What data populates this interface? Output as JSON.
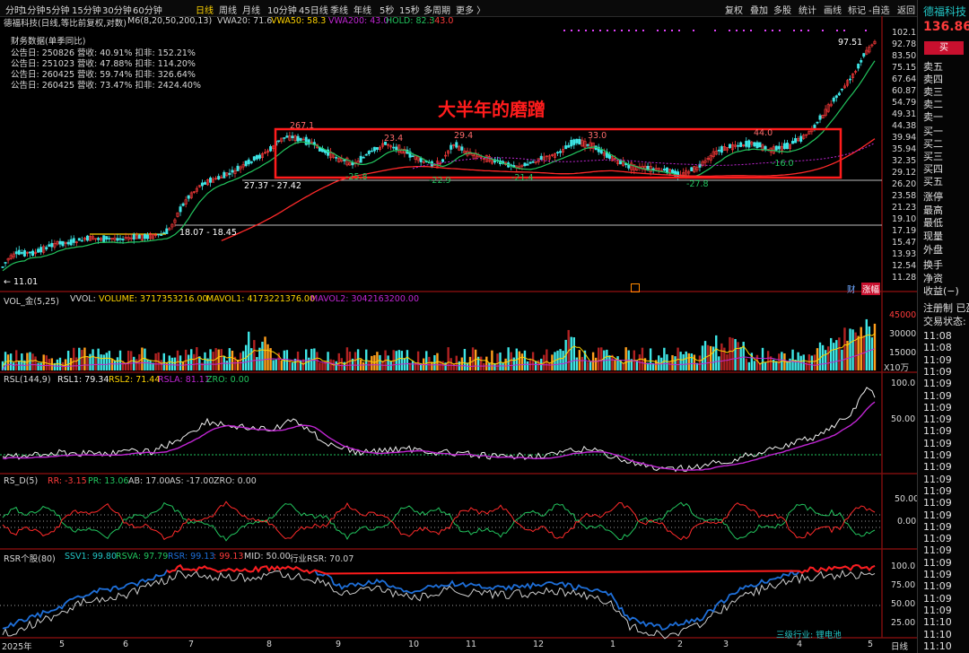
{
  "toolbar": {
    "periods": [
      "分时",
      "1分钟",
      "5分钟",
      "15分钟",
      "30分钟",
      "60分钟",
      "日线",
      "周线",
      "月线",
      "10分钟",
      "45日线",
      "季线",
      "年线",
      "5秒",
      "15秒",
      "多周期",
      "更多 〉"
    ],
    "active_period": "日线",
    "tools": [
      "复权",
      "叠加",
      "多股",
      "统计",
      "画线",
      "标记",
      "-自选",
      "返回"
    ]
  },
  "stock": {
    "name": "德福科技",
    "price": "136.86",
    "buy_button": "买",
    "quote_labels": [
      "卖五",
      "卖四",
      "卖三",
      "卖二",
      "卖一",
      "买一",
      "买二",
      "买三",
      "买四",
      "买五",
      "涨停",
      "最高",
      "最低",
      "现量",
      "外盘",
      "换手",
      "净资",
      "收益(−)"
    ],
    "reg_line": "注册制 已盈",
    "trade_status": "交易状态: 正"
  },
  "ticks": {
    "times": [
      "11:08",
      "11:08",
      "11:09",
      "11:09",
      "11:09",
      "11:09",
      "11:09",
      "11:09",
      "11:09",
      "11:09",
      "11:09",
      "11:09",
      "11:09",
      "11:09",
      "11:09",
      "11:09",
      "11:09",
      "11:09",
      "11:09",
      "11:09",
      "11:09",
      "11:09",
      "11:09",
      "11:09",
      "11:10",
      "11:10",
      "11:10"
    ]
  },
  "main_panel": {
    "header_name": "德福科技(日线,等比前复权,对数)",
    "header_ma": "M6(8,20,50,200,13)",
    "header_vwa20": "VWA20: 71.6",
    "header_vwa50": "VWA50: 58.3",
    "header_vwa200": "VWA200: 43.0",
    "header_hold": "HOLD: 82.3",
    "header_hold2": ": 43.0",
    "finance_title": "财务数据(单季同比)",
    "finance_rows": [
      "公告日: 250826  营收:  40.91%  扣非:  152.21%",
      "公告日: 251023  营收:  47.88%  扣非:  114.20%",
      "公告日: 260425  营收:  59.74%  扣非:  326.64%",
      "公告日: 260425  营收:  73.47%  扣非:  2424.40%"
    ],
    "annotation_title": "大半年的磨蹭",
    "price_labels": [
      "267.1",
      "23.4",
      "29.4",
      "33.0",
      "44.0",
      "97.51",
      "-16.0",
      "-27.8",
      "-22.9",
      "-21.4",
      "-25.8",
      "27.37 - 27.42",
      "18.07 - 18.45",
      "← 11.01"
    ],
    "y_ticks": [
      "102.1",
      "92.78",
      "83.50",
      "75.15",
      "67.64",
      "60.87",
      "54.79",
      "49.31",
      "44.38",
      "39.94",
      "35.94",
      "32.35",
      "29.12",
      "26.20",
      "23.58",
      "21.23",
      "19.10",
      "17.19",
      "15.47",
      "13.93",
      "12.54",
      "11.28"
    ],
    "badges": [
      "财",
      "涨幅"
    ]
  },
  "vol_panel": {
    "header_name": "VOL_金(5,25)",
    "header_vvol": "VVOL:",
    "header_volume": "VOLUME: 3717353216.00",
    "header_mavol1": "MAVOL1: 4173221376.00",
    "header_mavol2": "MAVOL2: 3042163200.00",
    "y_ticks": [
      "45000",
      "30000",
      "15000"
    ],
    "unit": "X10万"
  },
  "rsl_panel": {
    "header_name": "RSL(144,9)",
    "header_rsl1": "RSL1: 79.34",
    "header_rsl2": "RSL2: 71.44",
    "header_rsla": "RSLA: 81.11",
    "header_zro": "ZRO: 0.00",
    "y_ticks": [
      "100.0",
      "50.00"
    ]
  },
  "rsd_panel": {
    "header_name": "RS_D(5)",
    "header_rr": "RR: -3.15",
    "header_pr": "PR: 13.06",
    "header_ab": "AB: 17.00",
    "header_as": "AS: -17.00",
    "header_zro": "ZRO: 0.00",
    "y_ticks": [
      "50.00",
      "0.00"
    ]
  },
  "rsr_panel": {
    "header_name": "RSR个股(80)",
    "header_ssv1": "SSV1: 99.80",
    "header_rsva": "RSVA: 97.79",
    "header_rsr": "RSR: 99.13",
    "header_rsr2": ": 99.13",
    "header_mid": "MID: 50.00",
    "header_ind": "行业RSR: 70.07",
    "y_ticks": [
      "100.0",
      "75.00",
      "50.00",
      "25.00"
    ],
    "industry_label": "三级行业: 锂电池"
  },
  "x_axis": {
    "labels": [
      "2025年",
      "5",
      "6",
      "7",
      "8",
      "9",
      "10",
      "11",
      "12",
      "1",
      "2",
      "3",
      "4",
      "5"
    ],
    "period_label": "日线"
  },
  "colors": {
    "up": "#ff3b3b",
    "down": "#3ee6e6",
    "ma_green": "#22c55e",
    "ma_red": "#ff2a2a",
    "purple": "#c026d3",
    "yellow": "#ffd400",
    "annotation": "#ff1c1c"
  },
  "chart_data": [
    {
      "type": "line",
      "title": "德福科技(日线,等比前复权,对数)",
      "x": [
        "2025年",
        "5",
        "6",
        "7",
        "8",
        "9",
        "10",
        "11",
        "12",
        "1",
        "2",
        "3",
        "4",
        "5"
      ],
      "series": [
        {
          "name": "Close",
          "values": [
            11.0,
            14.5,
            16.0,
            25.0,
            38.0,
            32.0,
            33.0,
            33.5,
            33.0,
            30.0,
            28.0,
            34.0,
            38.0,
            95.0
          ]
        }
      ],
      "ylim": [
        11.28,
        102.1
      ],
      "log_scale": true,
      "annotations": [
        "267.1",
        "23.4",
        "29.4",
        "33.0",
        "44.0",
        "97.51",
        "-16.0",
        "-27.8",
        "-22.9",
        "-21.4",
        "-25.8",
        "27.37 - 27.42",
        "18.07 - 18.45",
        "11.01"
      ]
    },
    {
      "type": "bar",
      "title": "VOL_金(5,25)",
      "series": [
        {
          "name": "VOLUME",
          "values": [
            3717353216.0
          ]
        },
        {
          "name": "MAVOL1",
          "values": [
            4173221376.0
          ]
        },
        {
          "name": "MAVOL2",
          "values": [
            3042163200.0
          ]
        }
      ]
    },
    {
      "type": "line",
      "title": "RSL(144,9)",
      "series": [
        {
          "name": "RSL1",
          "values": [
            79.34
          ]
        },
        {
          "name": "RSL2",
          "values": [
            71.44
          ]
        },
        {
          "name": "RSLA",
          "values": [
            81.11
          ]
        }
      ],
      "ylim": [
        0,
        100
      ]
    },
    {
      "type": "line",
      "title": "RS_D(5)",
      "series": [
        {
          "name": "RR",
          "values": [
            -3.15
          ]
        },
        {
          "name": "PR",
          "values": [
            13.06
          ]
        }
      ]
    },
    {
      "type": "line",
      "title": "RSR个股(80)",
      "series": [
        {
          "name": "SSV1",
          "values": [
            99.8
          ]
        },
        {
          "name": "RSVA",
          "values": [
            97.79
          ]
        },
        {
          "name": "RSR",
          "values": [
            99.13
          ]
        }
      ],
      "ylim": [
        0,
        100
      ]
    }
  ]
}
